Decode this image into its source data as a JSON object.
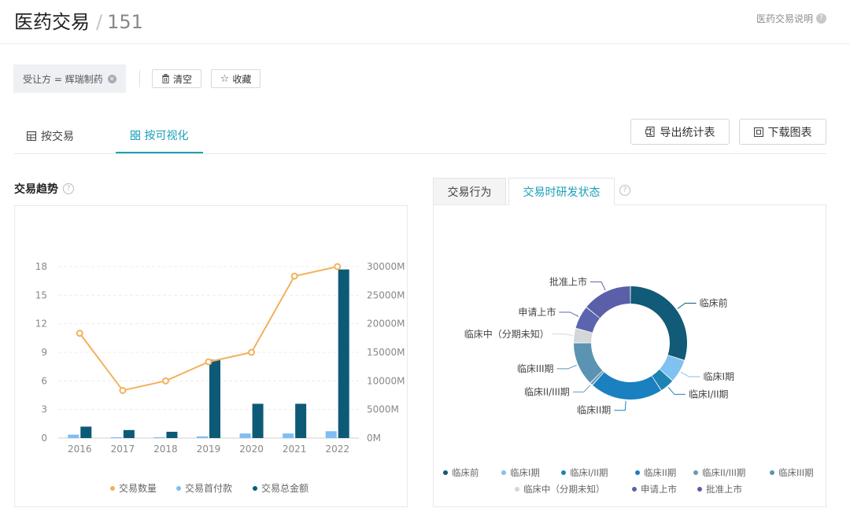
{
  "header": {
    "title": "医药交易",
    "separator": "/",
    "count": "151",
    "help_link": "医药交易说明"
  },
  "filter": {
    "tag_label": "受让方 = 辉瑞制药",
    "clear_label": "清空",
    "favorite_label": "收藏"
  },
  "view_tabs": [
    {
      "label": "按交易",
      "icon": "table-icon",
      "active": false
    },
    {
      "label": "按可视化",
      "icon": "grid-icon",
      "active": true
    }
  ],
  "actions": {
    "export_label": "导出统计表",
    "download_label": "下载图表"
  },
  "trend_section": {
    "title": "交易趋势"
  },
  "right_tabs": [
    {
      "label": "交易行为",
      "active": false
    },
    {
      "label": "交易时研发状态",
      "active": true
    }
  ],
  "chart_data": [
    {
      "type": "bar",
      "title": "交易趋势",
      "categories": [
        "2016",
        "2017",
        "2018",
        "2019",
        "2020",
        "2021",
        "2022"
      ],
      "y_left": {
        "ticks": [
          0,
          3,
          6,
          9,
          12,
          15,
          18
        ],
        "lim": [
          0,
          18
        ]
      },
      "y_right": {
        "ticks": [
          "0M",
          "5000M",
          "10000M",
          "15000M",
          "20000M",
          "25000M",
          "30000M"
        ],
        "lim": [
          0,
          30000
        ]
      },
      "series": [
        {
          "name": "交易数量",
          "type": "line",
          "axis": "left",
          "color": "#f2b15c",
          "values": [
            11,
            5,
            6,
            8,
            9,
            17,
            18
          ]
        },
        {
          "name": "交易首付款",
          "type": "bar",
          "axis": "right",
          "color": "#7fbdf2",
          "values": [
            600,
            150,
            150,
            300,
            800,
            800,
            1200
          ]
        },
        {
          "name": "交易总金额",
          "type": "bar",
          "axis": "right",
          "color": "#0d5a77",
          "values": [
            2000,
            1400,
            1100,
            13700,
            6000,
            6000,
            29500
          ]
        }
      ],
      "legend": "bottom",
      "grid": true
    },
    {
      "type": "pie",
      "title": "交易时研发状态",
      "donut": true,
      "slices": [
        {
          "label": "临床前",
          "value": 36,
          "color": "#115a78"
        },
        {
          "label": "临床I期",
          "value": 8,
          "color": "#7fc1f0"
        },
        {
          "label": "临床I/II期",
          "value": 5,
          "color": "#1d83b4"
        },
        {
          "label": "临床II期",
          "value": 25,
          "color": "#1a80c0"
        },
        {
          "label": "临床II/III期",
          "value": 1,
          "color": "#6a9ab6"
        },
        {
          "label": "临床III期",
          "value": 15,
          "color": "#5b93b2"
        },
        {
          "label": "临床中（分期未知）",
          "value": 5,
          "color": "#d4d6da"
        },
        {
          "label": "申请上市",
          "value": 8,
          "color": "#5b64ae"
        },
        {
          "label": "批准上市",
          "value": 17,
          "color": "#5b5ea8"
        }
      ],
      "legend": "bottom"
    }
  ]
}
